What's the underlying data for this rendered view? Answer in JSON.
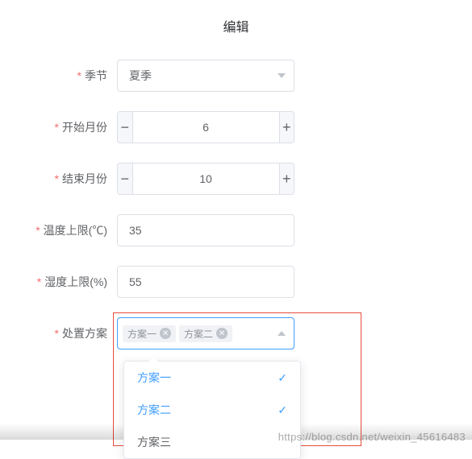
{
  "title": "编辑",
  "fields": {
    "season": {
      "label": "季节",
      "value": "夏季"
    },
    "startMonth": {
      "label": "开始月份",
      "value": "6"
    },
    "endMonth": {
      "label": "结束月份",
      "value": "10"
    },
    "tempMax": {
      "label": "温度上限(℃)",
      "value": "35"
    },
    "humidityMax": {
      "label": "湿度上限(%)",
      "value": "55"
    },
    "plan": {
      "label": "处置方案"
    }
  },
  "selectedTags": [
    "方案一",
    "方案二"
  ],
  "dropdownOptions": [
    {
      "label": "方案一",
      "selected": true
    },
    {
      "label": "方案二",
      "selected": true
    },
    {
      "label": "方案三",
      "selected": false
    }
  ],
  "watermark": "https://blog.csdn.net/weixin_45616483"
}
